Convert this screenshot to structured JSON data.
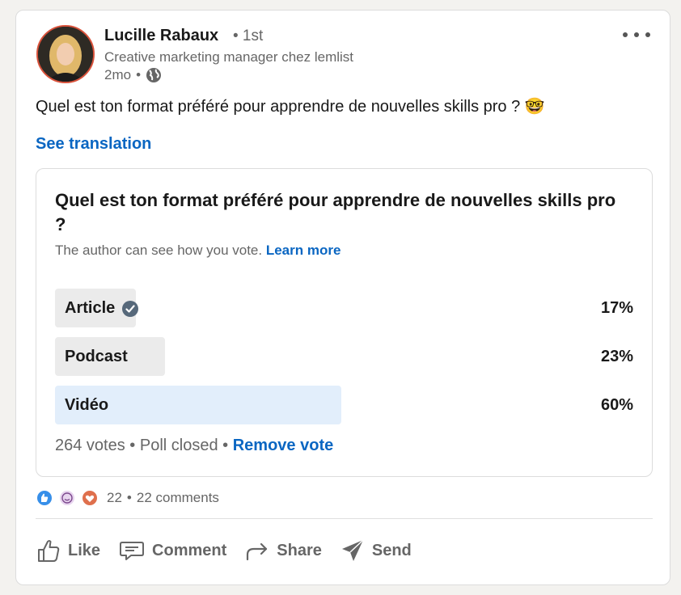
{
  "post": {
    "author": {
      "name": "Lucille Rabaux",
      "degree": "• 1st",
      "headline": "Creative marketing manager chez lemlist",
      "time": "2mo",
      "dot": "•"
    },
    "text": "Quel est ton format préféré pour apprendre de nouvelles skills pro ? 🤓",
    "see_translation": "See translation"
  },
  "poll": {
    "question": "Quel est ton format préféré pour apprendre de nouvelles skills pro ?",
    "note": "The author can see how you vote.",
    "learn_more": "Learn more",
    "options": [
      {
        "label": "Article",
        "percent": "17%",
        "share": 0.17,
        "voted": true
      },
      {
        "label": "Podcast",
        "percent": "23%",
        "share": 0.23,
        "voted": false
      },
      {
        "label": "Vidéo",
        "percent": "60%",
        "share": 0.6,
        "voted": false
      }
    ],
    "votes": "264 votes",
    "status": "Poll closed",
    "sep": "•",
    "remove_vote": "Remove vote"
  },
  "social": {
    "reaction_icons": [
      "like-icon",
      "funny-icon",
      "love-icon"
    ],
    "reaction_count": "22",
    "sep": "•",
    "comments": "22 comments"
  },
  "actions": {
    "like": "Like",
    "comment": "Comment",
    "share": "Share",
    "send": "Send"
  },
  "colors": {
    "link": "#0a66c2",
    "winner_bar": "#e2eefb",
    "bar": "#ebebeb",
    "avatar_ring": "#d9523b"
  }
}
